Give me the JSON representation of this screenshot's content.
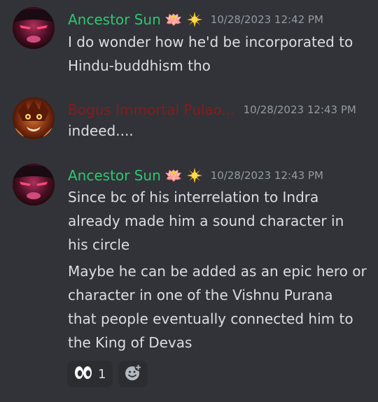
{
  "messages": [
    {
      "username": "Ancestor Sun",
      "timestamp": "10/28/2023 12:42 PM",
      "lines": [
        "I do wonder how he'd be incorporated to",
        "Hindu-buddhism tho"
      ]
    },
    {
      "username": "Bogus Immortal Pulao...",
      "timestamp": "10/28/2023 12:43 PM",
      "lines": [
        "indeed...."
      ]
    },
    {
      "username": "Ancestor Sun",
      "timestamp": "10/28/2023 12:43 PM",
      "lines": [
        "Since bc of his interrelation to Indra",
        "already made him a sound character in",
        "his circle",
        "Maybe he can be added as an epic hero or",
        "character in one of the Vishnu Purana",
        "that people eventually connected him to",
        "the King of Devas"
      ]
    }
  ],
  "badges": {
    "lotus": "🪷",
    "sun": "☀"
  },
  "reactions": [
    {
      "emoji": "👀",
      "count": "1"
    }
  ],
  "colors": {
    "background": "#313338",
    "ancestor_name": "#2dc770",
    "bogus_name": "#8b1a1a",
    "text": "#dbdee1",
    "timestamp": "#949ba4"
  }
}
